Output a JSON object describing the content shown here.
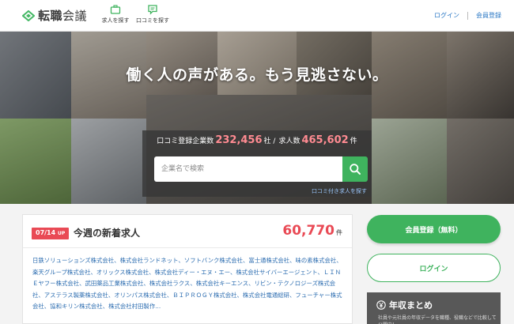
{
  "header": {
    "logo_main": "転職",
    "logo_sub": "会議",
    "nav_jobs": "求人を探す",
    "nav_reviews": "口コミを探す",
    "login": "ログイン",
    "register": "会員登録"
  },
  "hero": {
    "title": "働く人の声がある。もう見逃さない。",
    "stats_prefix": "口コミ登録企業数",
    "companies_count": "232,456",
    "companies_unit": "社 /",
    "jobs_label": "求人数",
    "jobs_count": "465,602",
    "jobs_unit": "件",
    "search_placeholder": "企業名で検索",
    "review_link": "口コミ付き求人を探す"
  },
  "new_jobs": {
    "badge_date": "07/14",
    "badge_suffix": "UP",
    "title": "今週の新着求人",
    "count": "60,770",
    "count_unit": "件",
    "companies_text": "日鉄ソリューションズ株式会社、株式会社ランドネット、ソフトバンク株式会社、富士通株式会社、味の素株式会社、楽天グループ株式会社、オリックス株式会社、株式会社ディー・エヌ・エー、株式会社サイバーエージェント、ＬＩＮＥヤフー株式会社、武田薬品工業株式会社、株式会社ラクス、株式会社キーエンス、リビン・テクノロジーズ株式会社、アステラス製薬株式会社、オリンパス株式会社、ＢＩＰＲＯＧＹ株式会社、株式会社電通総研、フューチャー株式会社、協和キリン株式会社、株式会社村田製作..."
  },
  "side": {
    "register_button": "会員登録（無料）",
    "login_button": "ログイン",
    "salary_title": "年収まとめ",
    "salary_sub": "社員や元社員の年収データを職種、役職などで比較して公開中！"
  },
  "colors": {
    "accent_green": "#3fb35e",
    "accent_red": "#e94a55",
    "link_blue": "#2b78c5"
  }
}
